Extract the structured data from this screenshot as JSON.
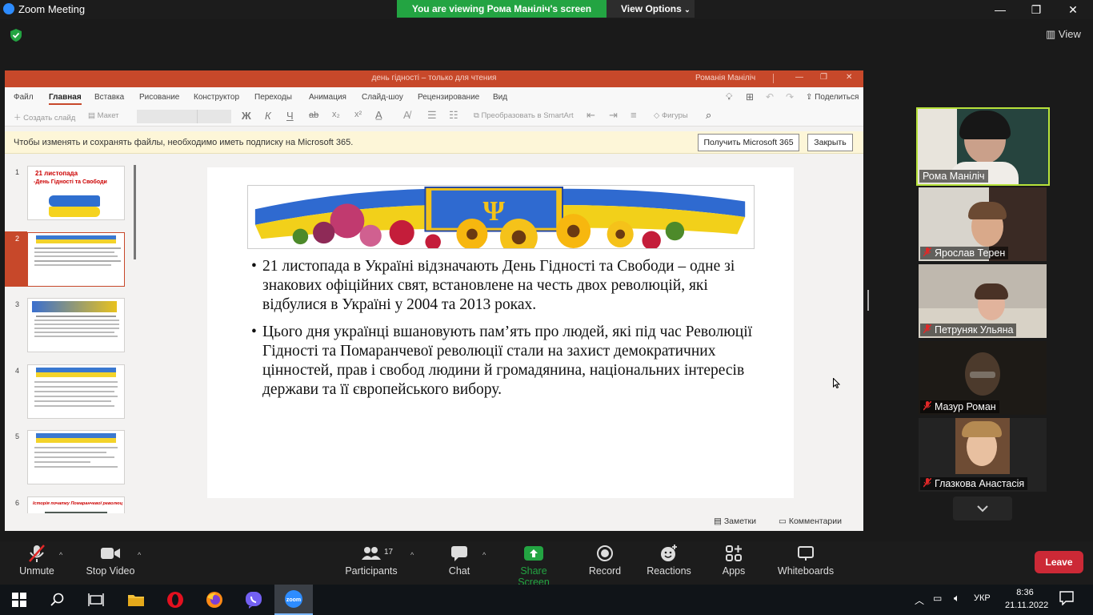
{
  "window": {
    "title": "Zoom Meeting",
    "minimize": "—",
    "maximize": "❐",
    "close": "✕"
  },
  "banner": {
    "viewing": "You are viewing Рома Маніліч's screen",
    "view_options": "View Options"
  },
  "topbar": {
    "view_label": "View"
  },
  "ppt": {
    "doc_title": "день гідності – только для чтения",
    "user": "Романія Маніліч",
    "tabs": [
      "Файл",
      "Главная",
      "Вставка",
      "Рисование",
      "Конструктор",
      "Переходы",
      "Анимация",
      "Слайд-шоу",
      "Рецензирование",
      "Вид"
    ],
    "share_label": "Поделиться",
    "toolbar": {
      "new_slide": "Создать слайд",
      "layout": "Макет",
      "bold": "Ж",
      "italic": "К",
      "underline": "Ч",
      "strike": "ab",
      "smartart": "Преобразовать в SmartArt",
      "shapes": "Фигуры"
    },
    "notice": {
      "text": "Чтобы изменять и сохранять файлы, необходимо иметь подписку на Microsoft 365.",
      "get_button": "Получить Microsoft 365",
      "close_button": "Закрыть"
    },
    "thumbnails": [
      {
        "num": "1",
        "title1": "21 листопада",
        "title2": "-День Гідності та Свободи"
      },
      {
        "num": "2"
      },
      {
        "num": "3"
      },
      {
        "num": "4"
      },
      {
        "num": "5"
      },
      {
        "num": "6",
        "title1": "Історія початку Помаранчевої революції"
      }
    ],
    "slide": {
      "bullet1": "21 листопада в Україні відзначають День Гідності та Свободи – одне зі знакових офіційних свят, встановлене на честь двох революцій, які відбулися в Україні у 2004 та 2013 роках.",
      "bullet2": " Цього дня українці вшановують пам’ять про людей, які під час Революції Гідності та Помаранчевої революції стали на захист демократичних цінностей, прав і свобод людини й громадянина, національних інтересів держави та її європейського вибору."
    },
    "status": {
      "notes": "Заметки",
      "comments": "Комментарии"
    }
  },
  "participants": [
    {
      "name": "Рома Маніліч",
      "muted": false
    },
    {
      "name": "Ярослав Терен",
      "muted": true
    },
    {
      "name": "Петруняк Ульяна",
      "muted": true
    },
    {
      "name": "Мазур Роман",
      "muted": true
    },
    {
      "name": "Глазкова Анастасія",
      "muted": true
    }
  ],
  "controls": {
    "unmute": "Unmute",
    "stop_video": "Stop Video",
    "participants": "Participants",
    "participants_count": "17",
    "chat": "Chat",
    "share_screen": "Share Screen",
    "record": "Record",
    "reactions": "Reactions",
    "apps": "Apps",
    "whiteboards": "Whiteboards",
    "leave": "Leave"
  },
  "taskbar": {
    "lang": "УКР",
    "time": "8:36",
    "date": "21.11.2022"
  },
  "colors": {
    "zoom_green": "#23a442",
    "ppt_red": "#c7482a",
    "leave_red": "#cc2936",
    "active_border": "#b7e23a"
  }
}
